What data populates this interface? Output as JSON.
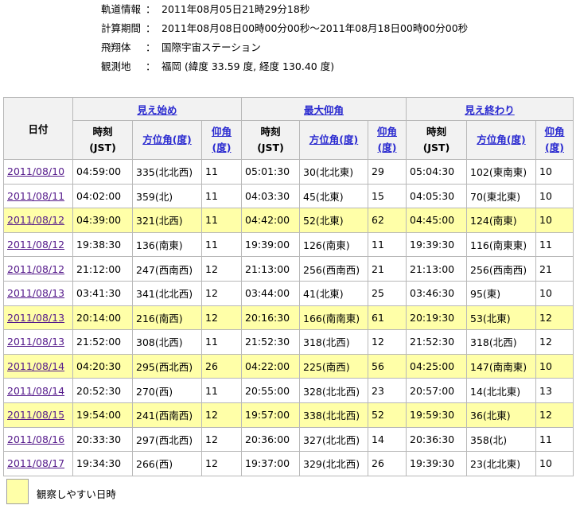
{
  "info": {
    "rows": [
      {
        "label": "軌道情報",
        "value": "2011年08月05日21時29分18秒"
      },
      {
        "label": "計算期間",
        "value": "2011年08月08日00時00分00秒～2011年08月18日00時00分00秒"
      },
      {
        "label": "飛翔体",
        "value": "国際宇宙ステーション"
      },
      {
        "label": "観測地",
        "value": "福岡 (緯度 33.59 度, 経度 130.40 度)"
      }
    ],
    "colon": "："
  },
  "table": {
    "date_header": "日付",
    "groups": [
      "見え始め",
      "最大仰角",
      "見え終わり"
    ],
    "sub": {
      "time": [
        "時刻",
        "(JST)"
      ],
      "az": "方位角(度)",
      "el": [
        "仰角",
        "(度)"
      ]
    },
    "rows": [
      {
        "date": "2011/08/10",
        "easy": false,
        "c": [
          "04:59:00",
          "335(北北西)",
          "11",
          "05:01:30",
          "30(北北東)",
          "29",
          "05:04:30",
          "102(東南東)",
          "10"
        ]
      },
      {
        "date": "2011/08/11",
        "easy": false,
        "c": [
          "04:02:00",
          "359(北)",
          "11",
          "04:03:30",
          "45(北東)",
          "15",
          "04:05:30",
          "70(東北東)",
          "10"
        ]
      },
      {
        "date": "2011/08/12",
        "easy": true,
        "c": [
          "04:39:00",
          "321(北西)",
          "11",
          "04:42:00",
          "52(北東)",
          "62",
          "04:45:00",
          "124(南東)",
          "10"
        ]
      },
      {
        "date": "2011/08/12",
        "easy": false,
        "c": [
          "19:38:30",
          "136(南東)",
          "11",
          "19:39:00",
          "126(南東)",
          "11",
          "19:39:30",
          "116(南東東)",
          "11"
        ]
      },
      {
        "date": "2011/08/12",
        "easy": false,
        "c": [
          "21:12:00",
          "247(西南西)",
          "12",
          "21:13:00",
          "256(西南西)",
          "21",
          "21:13:00",
          "256(西南西)",
          "21"
        ]
      },
      {
        "date": "2011/08/13",
        "easy": false,
        "c": [
          "03:41:30",
          "341(北北西)",
          "12",
          "03:44:00",
          "41(北東)",
          "25",
          "03:46:30",
          "95(東)",
          "10"
        ]
      },
      {
        "date": "2011/08/13",
        "easy": true,
        "c": [
          "20:14:00",
          "216(南西)",
          "12",
          "20:16:30",
          "166(南南東)",
          "61",
          "20:19:30",
          "53(北東)",
          "12"
        ]
      },
      {
        "date": "2011/08/13",
        "easy": false,
        "c": [
          "21:52:00",
          "308(北西)",
          "11",
          "21:52:30",
          "318(北西)",
          "12",
          "21:52:30",
          "318(北西)",
          "12"
        ]
      },
      {
        "date": "2011/08/14",
        "easy": true,
        "c": [
          "04:20:30",
          "295(西北西)",
          "26",
          "04:22:00",
          "225(南西)",
          "56",
          "04:25:00",
          "147(南南東)",
          "10"
        ]
      },
      {
        "date": "2011/08/14",
        "easy": false,
        "c": [
          "20:52:30",
          "270(西)",
          "11",
          "20:55:00",
          "328(北北西)",
          "23",
          "20:57:00",
          "14(北北東)",
          "13"
        ]
      },
      {
        "date": "2011/08/15",
        "easy": true,
        "c": [
          "19:54:00",
          "241(西南西)",
          "12",
          "19:57:00",
          "338(北北西)",
          "52",
          "19:59:30",
          "36(北東)",
          "12"
        ]
      },
      {
        "date": "2011/08/16",
        "easy": false,
        "c": [
          "20:33:30",
          "297(西北西)",
          "12",
          "20:36:00",
          "327(北北西)",
          "14",
          "20:36:30",
          "358(北)",
          "11"
        ]
      },
      {
        "date": "2011/08/17",
        "easy": false,
        "c": [
          "19:34:30",
          "266(西)",
          "12",
          "19:37:00",
          "329(北北西)",
          "26",
          "19:39:30",
          "23(北北東)",
          "10"
        ]
      }
    ]
  },
  "legend": {
    "text": "観察しやすい日時"
  },
  "colors": {
    "highlight": "#ffffa8",
    "link": "#2a2ad0",
    "visited_link": "#551a8b",
    "header_bg": "#f2f2f2"
  }
}
